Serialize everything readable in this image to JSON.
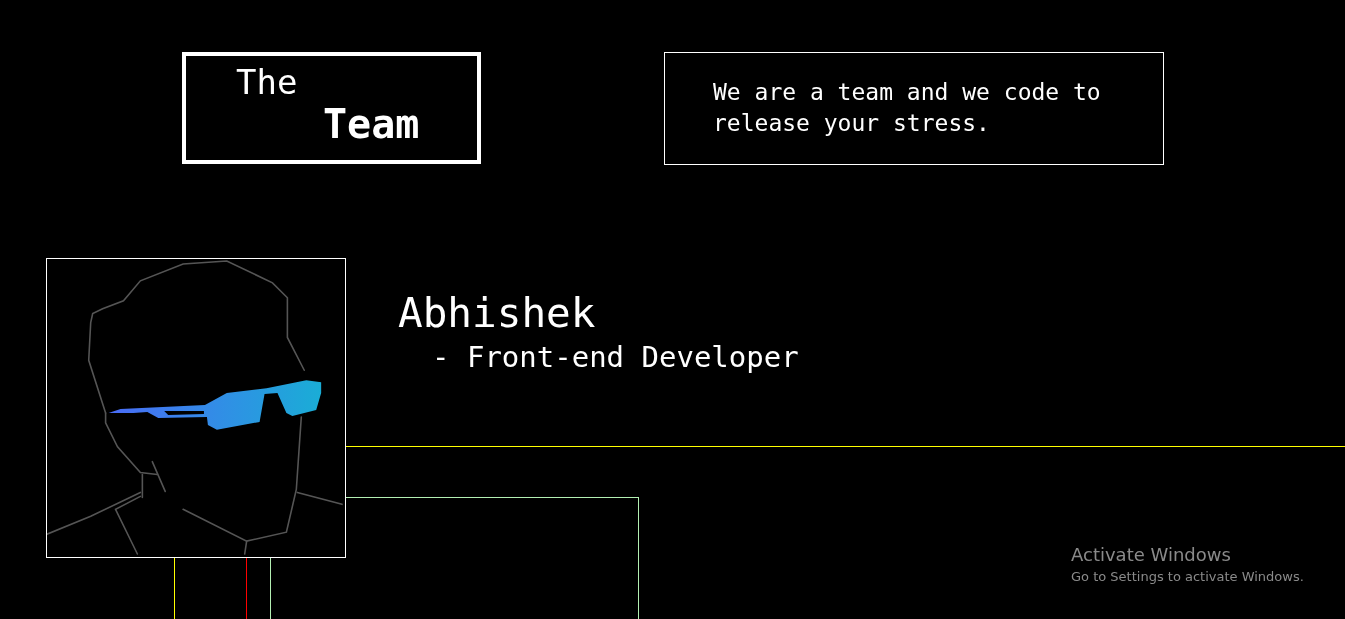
{
  "header": {
    "title_lines": [
      "The",
      "Team"
    ],
    "tagline": "We are a team and we code to release your stress."
  },
  "member": {
    "name": "Abhishek",
    "role": "- Front-end Developer"
  },
  "os_notice": {
    "title": "Activate Windows",
    "subtitle": "Go to Settings to activate Windows."
  }
}
